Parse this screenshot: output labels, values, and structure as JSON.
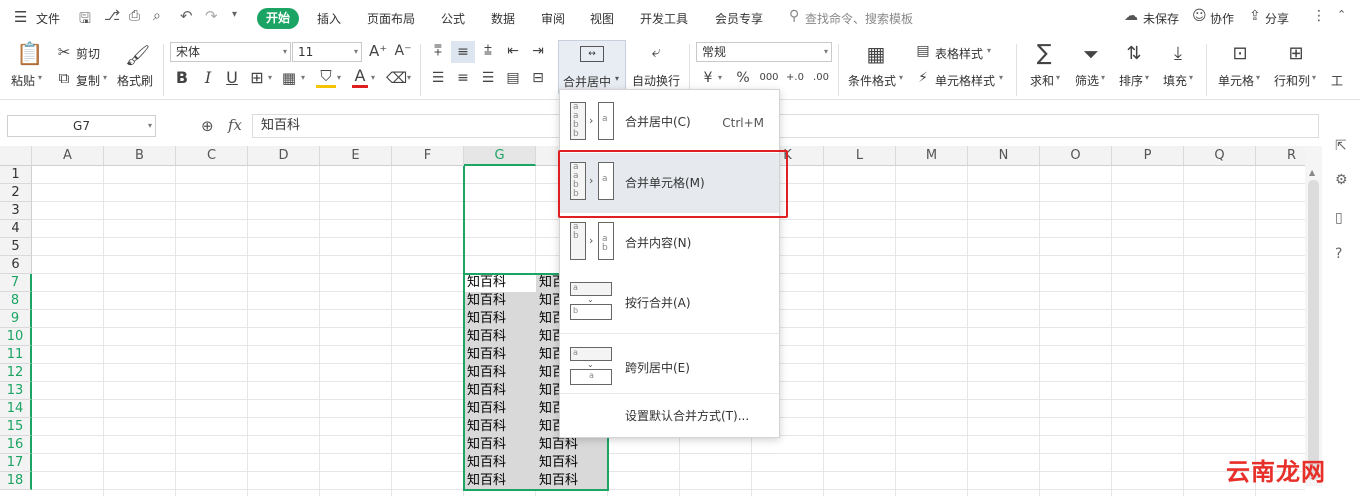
{
  "menubar": {
    "menu_label": "文件",
    "tabs": [
      "开始",
      "插入",
      "页面布局",
      "公式",
      "数据",
      "审阅",
      "视图",
      "开发工具",
      "会员专享"
    ],
    "search_placeholder": "查找命令、搜索模板",
    "unsaved": "未保存",
    "collaborate": "协作",
    "share": "分享"
  },
  "ribbon": {
    "paste": "粘贴",
    "cut": "剪切",
    "copy": "复制",
    "format_painter": "格式刷",
    "font_name": "宋体",
    "font_size": "11",
    "merge_center": "合并居中",
    "wrap_text": "自动换行",
    "number_format": "常规",
    "conditional_format": "条件格式",
    "table_style": "表格样式",
    "cell_style": "单元格样式",
    "sum": "求和",
    "filter": "筛选",
    "sort": "排序",
    "fill": "填充",
    "cell": "单元格",
    "row_col": "行和列",
    "currency_symbol": "¥",
    "percent_symbol": "%",
    "thousands_symbol": "000",
    "inc_decimal": "+.0",
    "dec_decimal": ".00",
    "font_color_letter": "A",
    "bold_letter": "B",
    "italic_letter": "I",
    "underline_letter": "U",
    "truncated_tool": "工"
  },
  "formula": {
    "cell_ref": "G7",
    "content": "知百科",
    "fx": "fx"
  },
  "sheet": {
    "columns": [
      "A",
      "B",
      "C",
      "D",
      "E",
      "F",
      "G",
      "H",
      "I",
      "J",
      "K",
      "L",
      "M",
      "N",
      "O",
      "P",
      "Q",
      "R"
    ],
    "rows": [
      "1",
      "2",
      "3",
      "4",
      "5",
      "6",
      "7",
      "8",
      "9",
      "10",
      "11",
      "12",
      "13",
      "14",
      "15",
      "16",
      "17",
      "18"
    ],
    "cell_text": "知百科",
    "partial_text": "知百"
  },
  "dropdown": {
    "items": [
      {
        "label": "合并居中(C)",
        "shortcut": "Ctrl+M"
      },
      {
        "label": "合并单元格(M)",
        "shortcut": ""
      },
      {
        "label": "合并内容(N)",
        "shortcut": ""
      },
      {
        "label": "按行合并(A)",
        "shortcut": ""
      },
      {
        "label": "跨列居中(E)",
        "shortcut": ""
      },
      {
        "label": "设置默认合并方式(T)...",
        "shortcut": ""
      }
    ],
    "icon_letters": [
      "a",
      "b"
    ]
  },
  "watermark": "云南龙网",
  "colors": {
    "accent": "#1ba463",
    "highlight_border": "#e02020",
    "selection_fill": "#d9d9d9"
  }
}
